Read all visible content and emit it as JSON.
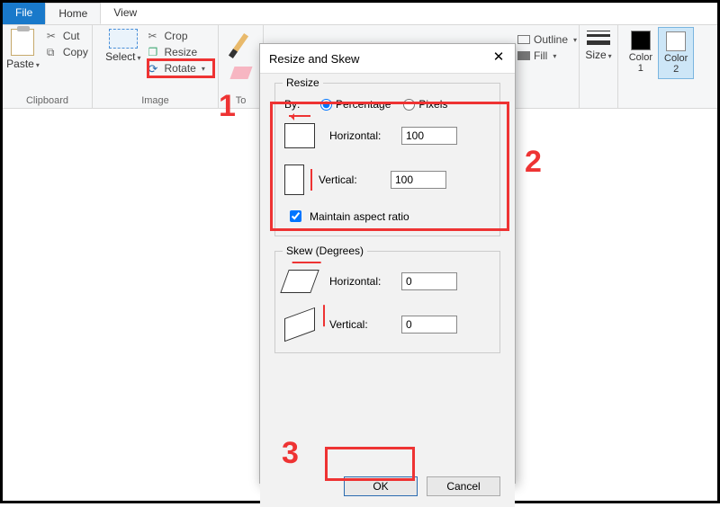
{
  "tabs": {
    "file": "File",
    "home": "Home",
    "view": "View"
  },
  "clipboard": {
    "paste": "Paste",
    "cut": "Cut",
    "copy": "Copy",
    "group": "Clipboard"
  },
  "image": {
    "select": "Select",
    "crop": "Crop",
    "resize": "Resize",
    "rotate": "Rotate",
    "group": "Image"
  },
  "tools": {
    "group": "To"
  },
  "shape": {
    "outline": "Outline",
    "fill": "Fill"
  },
  "size": {
    "label": "Size"
  },
  "colors": {
    "c1": "Color\n1",
    "c2": "Color\n2"
  },
  "dialog": {
    "title": "Resize and Skew",
    "resize": {
      "legend": "Resize",
      "by": "By:",
      "percentage": "Percentage",
      "pixels": "Pixels",
      "horizontal": "Horizontal:",
      "vertical": "Vertical:",
      "h_value": "100",
      "v_value": "100",
      "maintain": "Maintain aspect ratio"
    },
    "skew": {
      "legend": "Skew (Degrees)",
      "horizontal": "Horizontal:",
      "vertical": "Vertical:",
      "h_value": "0",
      "v_value": "0"
    },
    "ok": "OK",
    "cancel": "Cancel"
  },
  "annotations": {
    "n1": "1",
    "n2": "2",
    "n3": "3"
  }
}
